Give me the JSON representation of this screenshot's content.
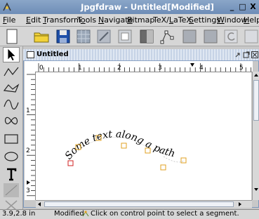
{
  "window": {
    "title": "Jpgfdraw - Untitled[Modified]",
    "min_glyph": "_",
    "max_glyph": "□",
    "close_glyph": "X"
  },
  "menubar": {
    "items": [
      {
        "label": "File",
        "mnemonic": "F",
        "rest": "ile"
      },
      {
        "label": "Edit",
        "mnemonic": "E",
        "rest": "dit"
      },
      {
        "label": "Transform",
        "mnemonic": "T",
        "rest": "ransform"
      },
      {
        "label": "Tools",
        "mnemonic": "o",
        "pre": "T",
        "rest": "ols"
      },
      {
        "label": "Navigate",
        "mnemonic": "N",
        "rest": "avigate"
      },
      {
        "label": "Bitmap",
        "mnemonic": "B",
        "rest": "itmap"
      },
      {
        "label": "TeX/LaTeX",
        "mnemonic": "L",
        "pre": "TeX/",
        "rest": "aTeX"
      },
      {
        "label": "Settings",
        "mnemonic": "S",
        "rest": "ettings"
      },
      {
        "label": "Window",
        "mnemonic": "W",
        "rest": "indow"
      },
      {
        "label": "Help",
        "mnemonic": "H",
        "rest": "elp"
      }
    ]
  },
  "document": {
    "title": "Untitled",
    "ruler_unit": "in",
    "h_ruler_labels": [
      "0",
      "1",
      "2",
      "3",
      "4",
      "5"
    ],
    "v_ruler_labels": [
      "1",
      "2",
      "3"
    ],
    "text_on_path": "Some text along a path"
  },
  "status": {
    "coords": "3.9,2.8 in",
    "modified": "Modified",
    "message": "Click on control point to select a segment."
  },
  "colors": {
    "titlebar": "#7b98c0",
    "control_point": "#e0a020",
    "selected_point": "#d02020"
  }
}
